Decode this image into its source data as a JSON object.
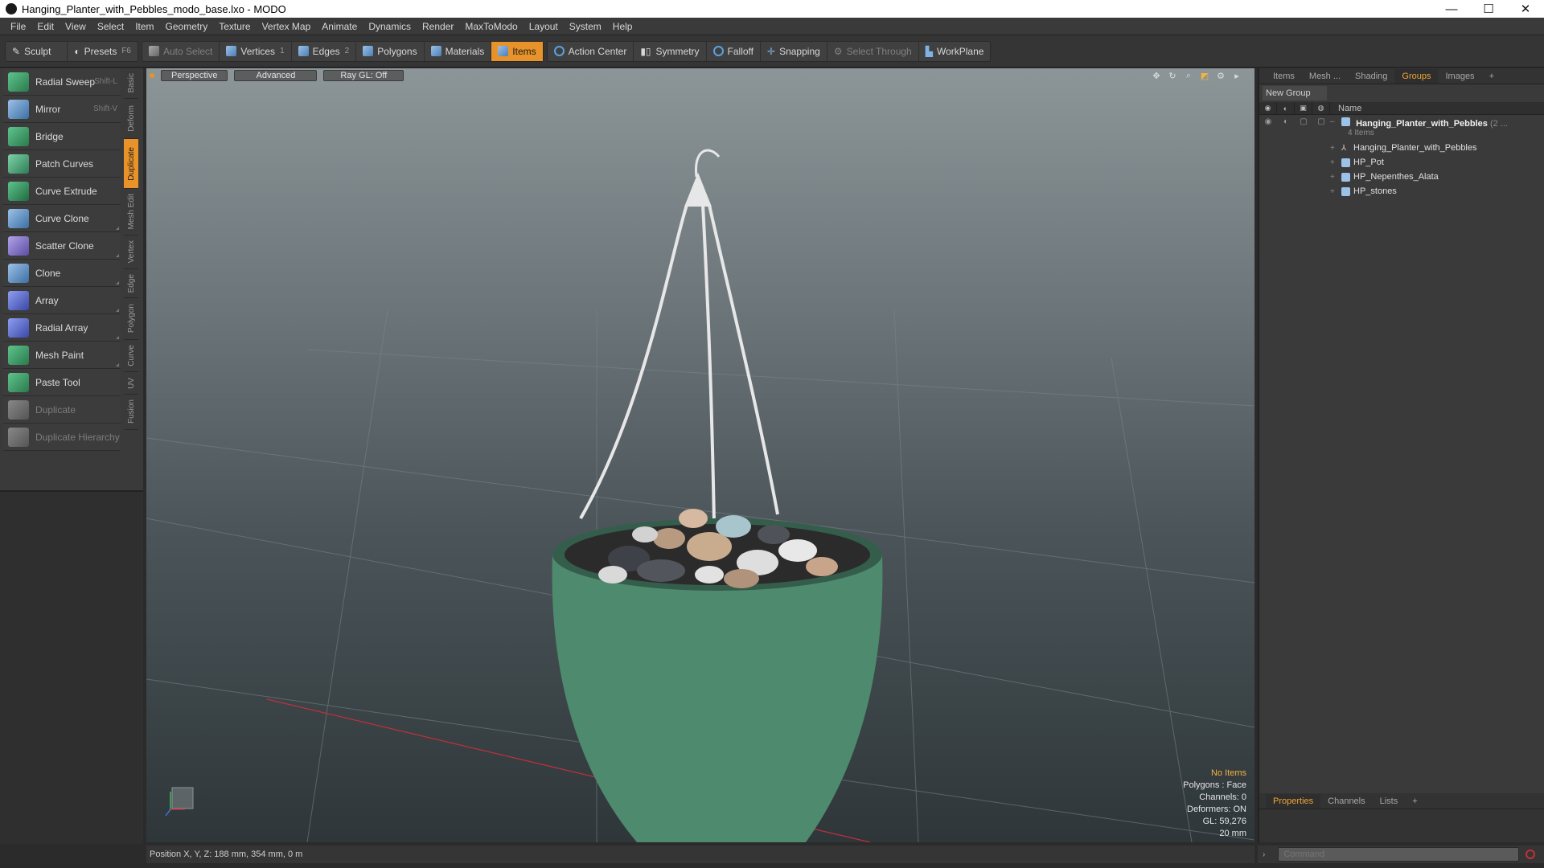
{
  "window": {
    "title": "Hanging_Planter_with_Pebbles_modo_base.lxo - MODO",
    "minimize": "—",
    "maximize": "☐",
    "close": "✕"
  },
  "menubar": {
    "items": [
      "File",
      "Edit",
      "View",
      "Select",
      "Item",
      "Geometry",
      "Texture",
      "Vertex Map",
      "Animate",
      "Dynamics",
      "Render",
      "MaxToModo",
      "Layout",
      "System",
      "Help"
    ]
  },
  "toolbar": {
    "sculpt": "Sculpt",
    "presets": "Presets",
    "presets_key": "F6",
    "auto_select": "Auto Select",
    "vertices": "Vertices",
    "vertices_num": "1",
    "edges": "Edges",
    "edges_num": "2",
    "polygons": "Polygons",
    "materials": "Materials",
    "items": "Items",
    "action_center": "Action Center",
    "symmetry": "Symmetry",
    "falloff": "Falloff",
    "snapping": "Snapping",
    "select_through": "Select Through",
    "workplane": "WorkPlane"
  },
  "tools": [
    {
      "label": "Radial Sweep",
      "key": "Shift-L"
    },
    {
      "label": "Mirror",
      "key": "Shift-V"
    },
    {
      "label": "Bridge",
      "key": ""
    },
    {
      "label": "Patch Curves",
      "key": ""
    },
    {
      "label": "Curve Extrude",
      "key": ""
    },
    {
      "label": "Curve Clone",
      "key": ""
    },
    {
      "label": "Scatter Clone",
      "key": ""
    },
    {
      "label": "Clone",
      "key": ""
    },
    {
      "label": "Array",
      "key": ""
    },
    {
      "label": "Radial Array",
      "key": ""
    },
    {
      "label": "Mesh Paint",
      "key": ""
    },
    {
      "label": "Paste Tool",
      "key": ""
    },
    {
      "label": "Duplicate",
      "key": ""
    },
    {
      "label": "Duplicate Hierarchy",
      "key": ""
    }
  ],
  "vertical_tabs": [
    "Basic",
    "Deform",
    "Duplicate",
    "Mesh Edit",
    "Vertex",
    "Edge",
    "Polygon",
    "Curve",
    "UV",
    "Fusion"
  ],
  "viewport": {
    "perspective": "Perspective",
    "advanced": "Advanced",
    "raygl": "Ray GL: Off",
    "info": {
      "no_items": "No Items",
      "polygons": "Polygons : Face",
      "channels": "Channels: 0",
      "deformers": "Deformers: ON",
      "gl": "GL: 59,276",
      "unit": "20 mm"
    }
  },
  "right_panel": {
    "tabs": [
      "Items",
      "Mesh ...",
      "Shading",
      "Groups",
      "Images",
      "+"
    ],
    "active_tab": "Groups",
    "new_group": "New Group",
    "name_header": "Name",
    "group": {
      "name": "Hanging_Planter_with_Pebbles",
      "count": "(2 ...",
      "sub": "4 Items"
    },
    "children": [
      "Hanging_Planter_with_Pebbles",
      "HP_Pot",
      "HP_Nepenthes_Alata",
      "HP_stones"
    ],
    "lower_tabs": [
      "Properties",
      "Channels",
      "Lists",
      "+"
    ]
  },
  "statusbar": {
    "position": "Position X, Y, Z:  188 mm, 354 mm, 0 m"
  },
  "command": {
    "placeholder": "Command"
  },
  "colors": {
    "accent": "#e8922a",
    "pot": "#4e8a6e"
  }
}
